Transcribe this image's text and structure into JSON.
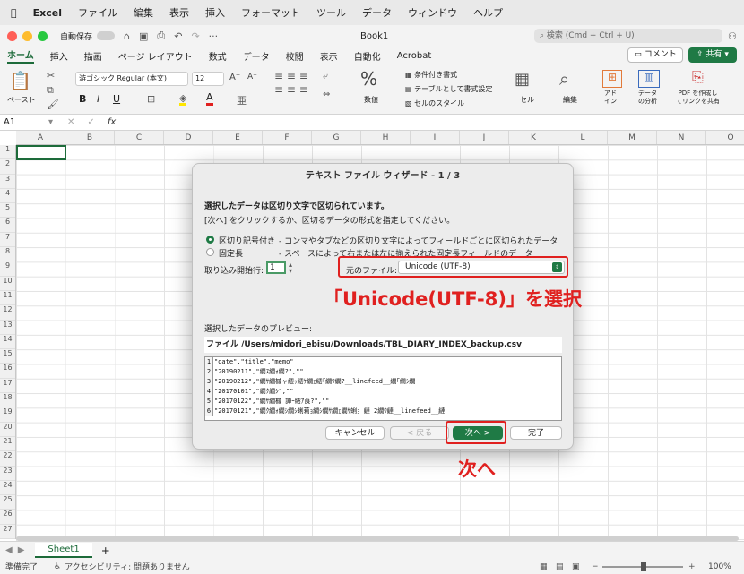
{
  "menubar": {
    "app": "Excel",
    "items": [
      "ファイル",
      "編集",
      "表示",
      "挿入",
      "フォーマット",
      "ツール",
      "データ",
      "ウィンドウ",
      "ヘルプ"
    ]
  },
  "titlebar": {
    "autosave": "自動保存",
    "title": "Book1",
    "search_placeholder": "検索 (Cmd + Ctrl + U)",
    "comment": "コメント",
    "share": "共有"
  },
  "ribbon": {
    "tabs": [
      "ホーム",
      "挿入",
      "描画",
      "ページ レイアウト",
      "数式",
      "データ",
      "校閲",
      "表示",
      "自動化",
      "Acrobat"
    ],
    "paste": "ペースト",
    "font": "游ゴシック Regular (本文)",
    "size": "12",
    "number": "数値",
    "cond_format": "条件付き書式",
    "table_format": "テーブルとして書式設定",
    "cell_style": "セルのスタイル",
    "cell": "セル",
    "edit": "編集",
    "addin": "アド\nイン",
    "analyze": "データ\nの分析",
    "pdf": "PDF を作成し\nてリンクを共有"
  },
  "formula_bar": {
    "name_box": "A1",
    "fx": "fx"
  },
  "columns": [
    "A",
    "B",
    "C",
    "D",
    "E",
    "F",
    "G",
    "H",
    "I",
    "J",
    "K",
    "L",
    "M",
    "N",
    "O"
  ],
  "rows": [
    "1",
    "2",
    "3",
    "4",
    "5",
    "6",
    "7",
    "8",
    "9",
    "10",
    "11",
    "12",
    "13",
    "14",
    "15",
    "16",
    "17",
    "18",
    "19",
    "20",
    "21",
    "22",
    "23",
    "24",
    "25",
    "26",
    "27"
  ],
  "sheet": {
    "tab": "Sheet1",
    "add": "+"
  },
  "status": {
    "ready": "準備完了",
    "accessibility": "アクセシビリティ: 問題ありません",
    "zoom": "100%"
  },
  "dialog": {
    "title": "テキスト ファイル ウィザード - 1 / 3",
    "line1": "選択したデータは区切り文字で区切られています。",
    "line2": "[次へ] をクリックするか、区切るデータの形式を指定してください。",
    "opt_delimited": "区切り記号付き",
    "opt_delimited_desc": "- コンマやタブなどの区切り文字によってフィールドごとに区切られたデータ",
    "opt_fixed": "固定長",
    "opt_fixed_desc": "- スペースによって右または左に揃えられた固定長フィールドのデータ",
    "start_row_label": "取り込み開始行:",
    "start_row": "1",
    "origin_label": "元のファイル:",
    "origin_value": "Unicode (UTF-8)",
    "preview_label": "選択したデータのプレビュー:",
    "file_path": "ファイル /Users/midori_ebisu/Downloads/TBL_DIARY_INDEX_backup.csv",
    "preview_rows": [
      {
        "n": "1",
        "t": "\"date\",\"title\",\"memo\""
      },
      {
        "n": "2",
        "t": "\"20190211\",\"繝ｽ繝ｫ繝?\",\"\""
      },
      {
        "n": "3",
        "t": "\"20190212\",\"繝ｻ繝槭ャ繧ｯ繧ｹ繝ｪ繧｢繝ｳ繝?__linefeed__繝｢繝ｼ繝"
      },
      {
        "n": "4",
        "t": "\"20170101\",\"繝ｸ繝ｼ\",\"\""
      },
      {
        "n": "5",
        "t": "\"20170122\",\"繝ｻ繝槭 譁ｰ繧ｱ莨?\",\"\""
      },
      {
        "n": "6",
        "t": "\"20170121\",\"繝ｸ繝ｫ繝ｼ繝ｼ蜊莉ｮ繝ｼ繝ｻ繝ｪ繝ｻ蜊ｮ 縺 2繝ｳ縺__linefeed__縺"
      }
    ],
    "cancel": "キャンセル",
    "back": "< 戻る",
    "next": "次へ >",
    "finish": "完了"
  },
  "annotations": {
    "select_utf8": "「Unicode(UTF-8)」を選択",
    "next": "次へ",
    "color": "#e0201f"
  }
}
